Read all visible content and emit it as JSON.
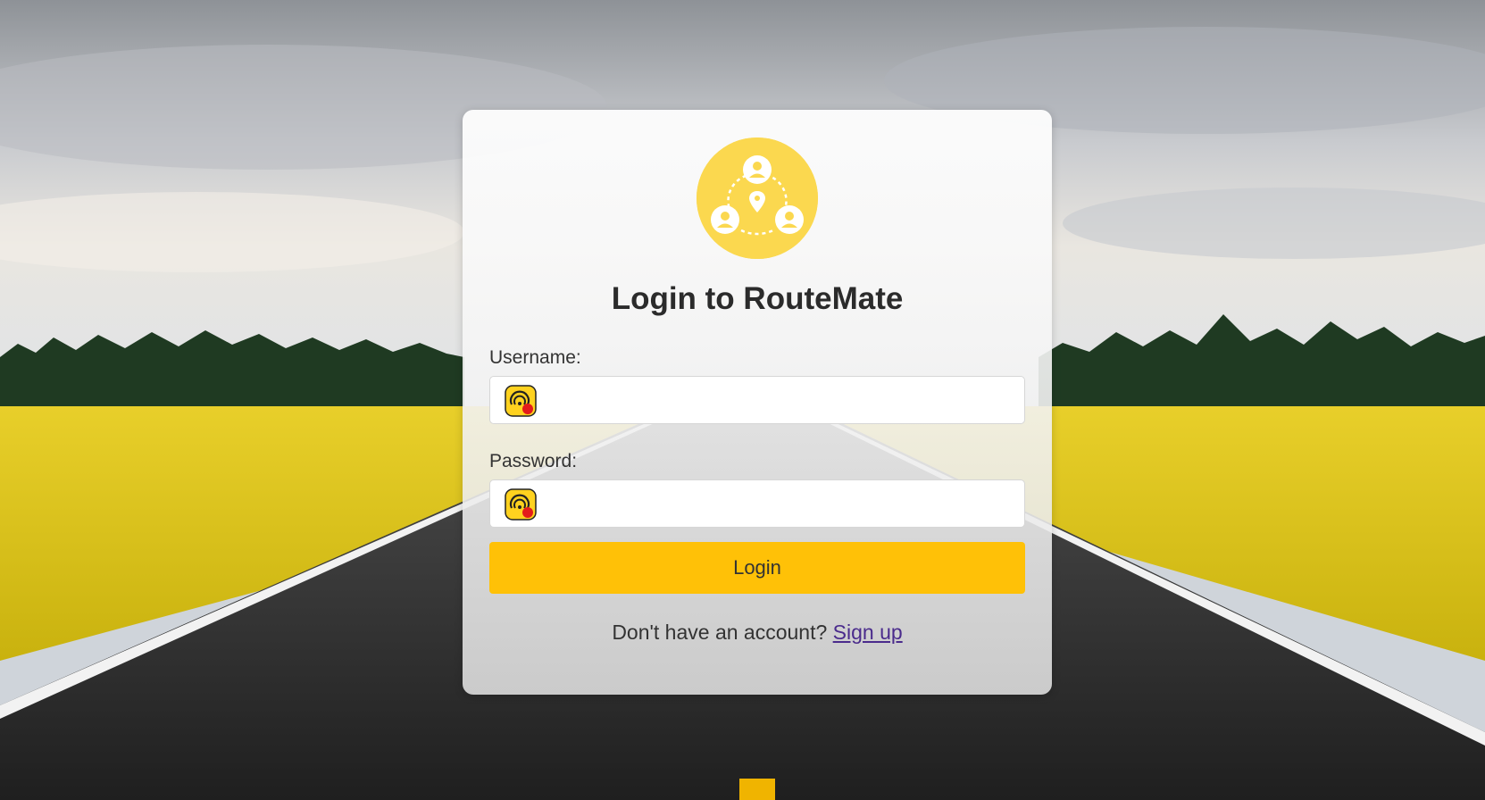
{
  "page": {
    "title": "Login to RouteMate",
    "logo_icon": "group-location-icon"
  },
  "form": {
    "username_label": "Username:",
    "username_value": "",
    "password_label": "Password:",
    "password_value": "",
    "field_badge_icon": "password-manager-extension-icon",
    "login_button_label": "Login"
  },
  "footer": {
    "prompt": "Don't have an account?",
    "signup_link": "Sign up"
  },
  "colors": {
    "accent": "#ffc107",
    "logo_background": "#fbd84f",
    "link": "#4a2b8c",
    "field_badge_background": "#ffd21f",
    "field_badge_dot": "#e31b1b"
  }
}
